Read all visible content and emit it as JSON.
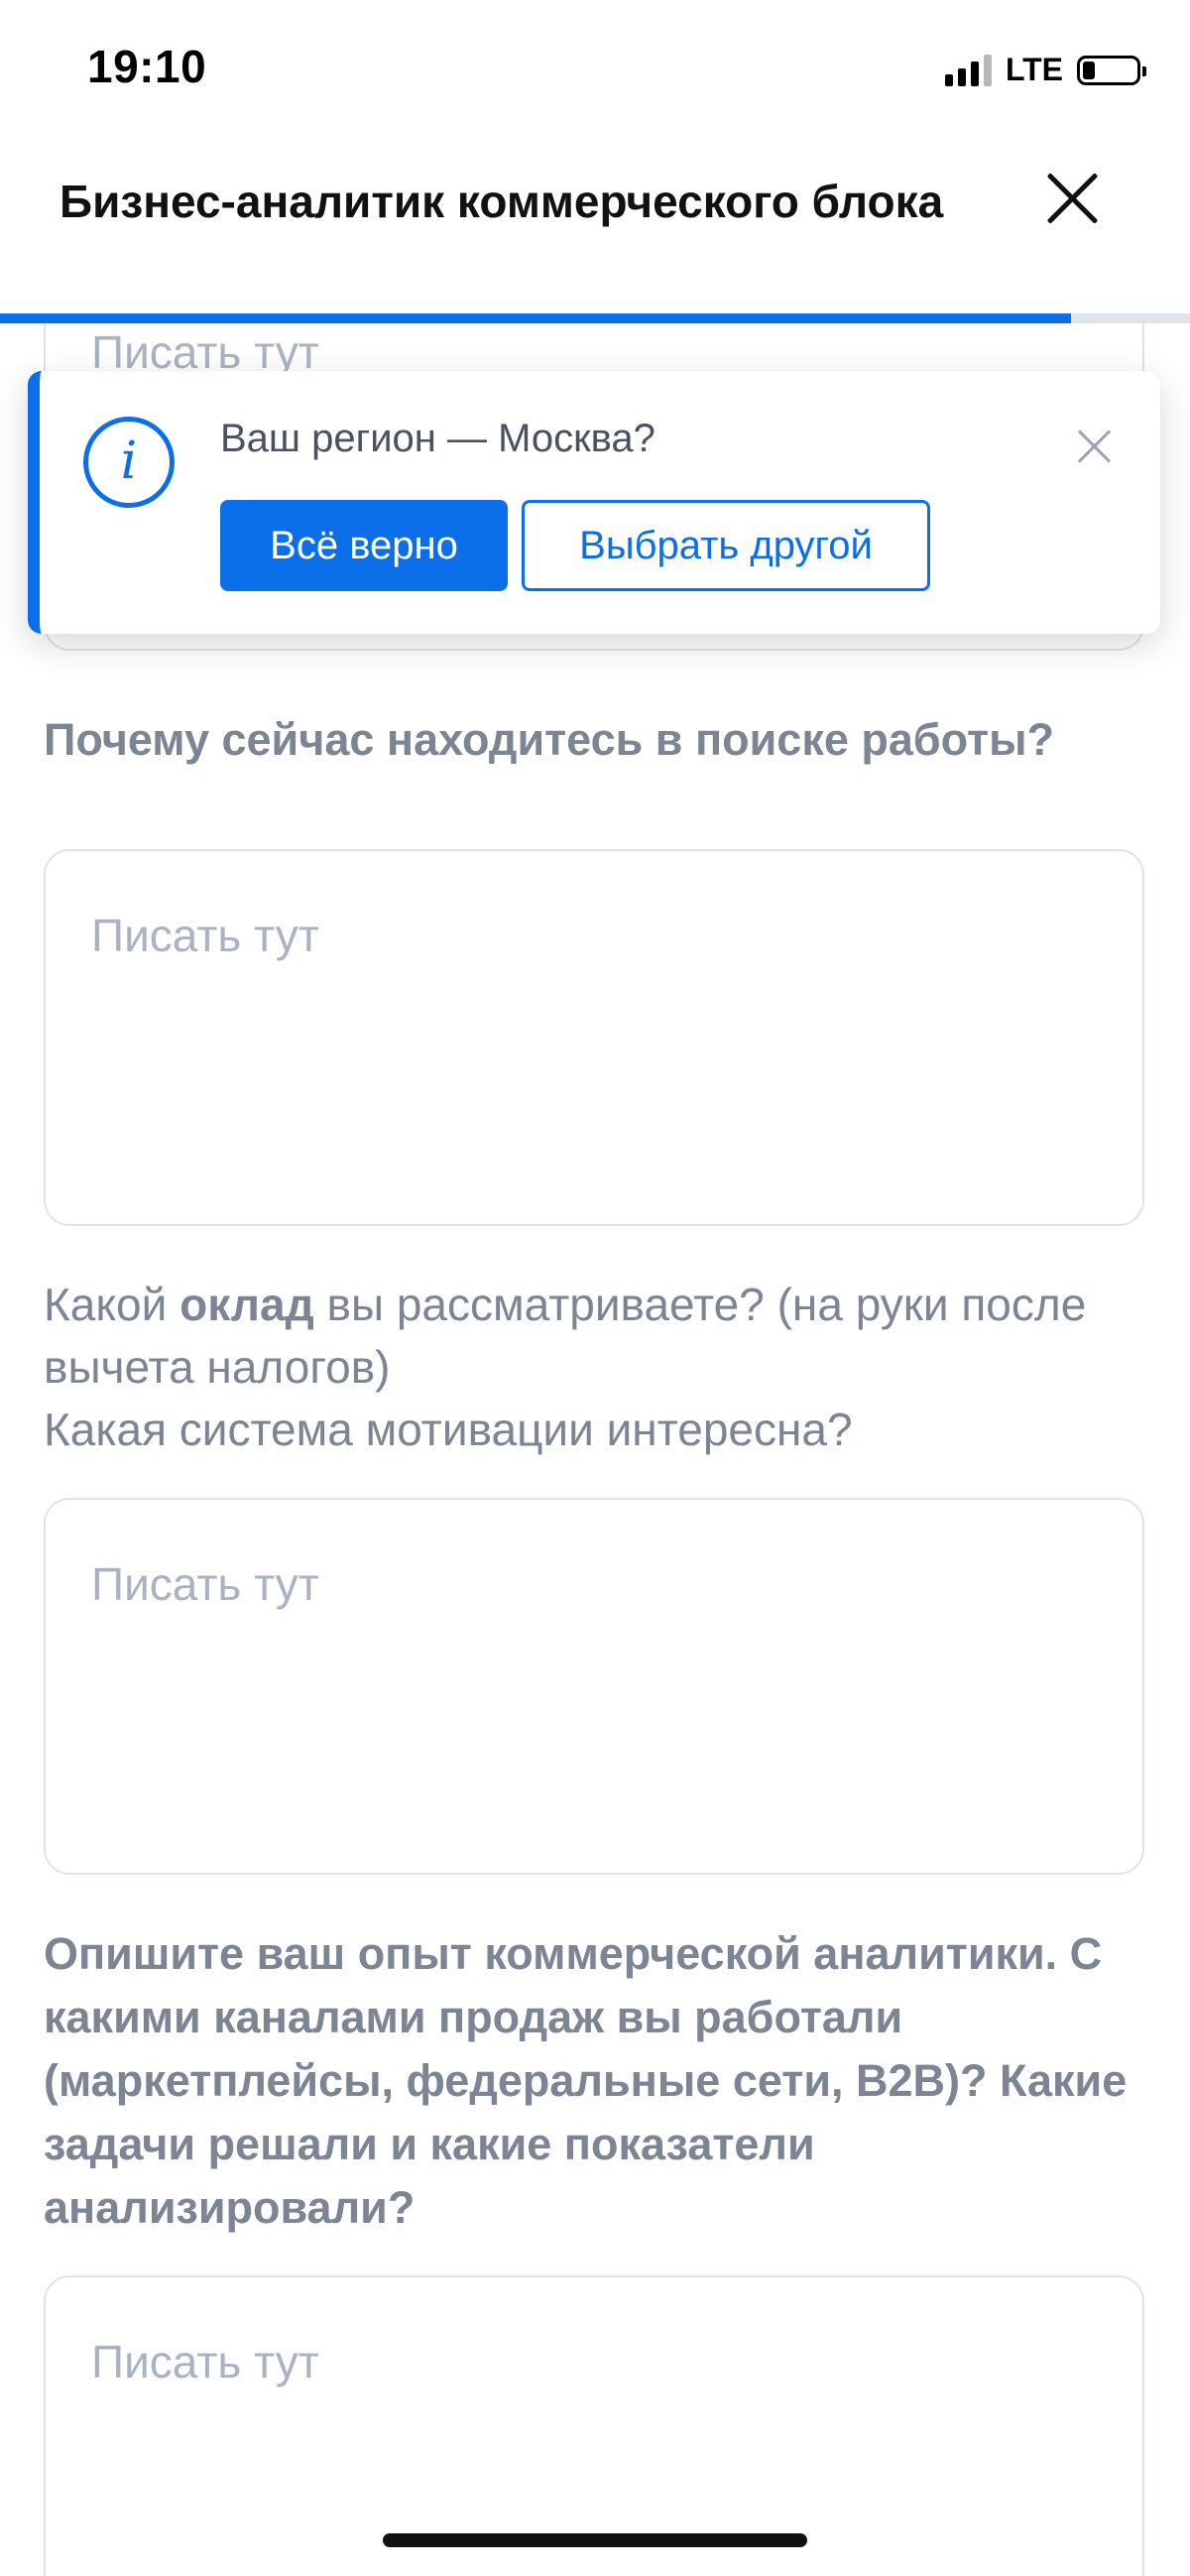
{
  "status_bar": {
    "time": "19:10",
    "network": "LTE"
  },
  "header": {
    "title": "Бизнес-аналитик коммерческого блока"
  },
  "progress": {
    "value_percent": 90
  },
  "colors": {
    "accent": "#0a6fe8",
    "question_text": "#7b8594",
    "placeholder": "#a9b4c2"
  },
  "form": {
    "placeholder": "Писать тут",
    "q1": "Почему сейчас находитесь в поиске работы?",
    "q2_part1": "Какой ",
    "q2_bold": "оклад",
    "q2_part2": " вы рассматриваете? (на руки после вычета налогов)",
    "q2_line2": "Какая система мотивации интересна?",
    "q3": "Опишите ваш опыт коммерческой аналитики. С какими каналами продаж вы работали (маркетплейсы, федеральные сети, B2B)? Какие задачи решали и какие показатели анализировали?"
  },
  "toast": {
    "message": "Ваш регион — Москва?",
    "confirm_label": "Всё верно",
    "other_label": "Выбрать другой",
    "icon": "info-icon"
  }
}
